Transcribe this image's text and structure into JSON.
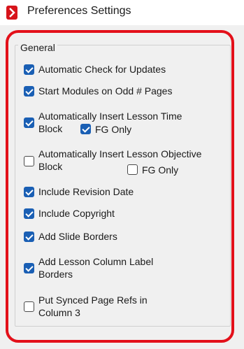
{
  "window": {
    "title": "Preferences Settings",
    "icon": "app-logo-icon"
  },
  "group": {
    "legend": "General"
  },
  "colors": {
    "checked": "#1a5fb4",
    "highlight": "#e3101a"
  },
  "options": {
    "auto_check_updates": {
      "label": "Automatic Check for Updates",
      "checked": true
    },
    "start_odd_pages": {
      "label": "Start Modules on Odd # Pages",
      "checked": true
    },
    "insert_time_block": {
      "label_line1": "Automatically Insert Lesson Time",
      "label_line2": "Block",
      "checked": true
    },
    "time_block_fg_only": {
      "label": "FG Only",
      "checked": true
    },
    "insert_objective_block": {
      "label_line1": "Automatically Insert Lesson Objective",
      "label_line2": "Block",
      "checked": false
    },
    "objective_block_fg_only": {
      "label": "FG Only",
      "checked": false
    },
    "include_revision_date": {
      "label": "Include Revision Date",
      "checked": true
    },
    "include_copyright": {
      "label": "Include Copyright",
      "checked": true
    },
    "add_slide_borders": {
      "label": "Add Slide Borders",
      "checked": true
    },
    "add_column_label_borders": {
      "label_line1": "Add Lesson Column Label",
      "label_line2": "Borders",
      "checked": true
    },
    "synced_page_refs_col3": {
      "label_line1": "Put Synced Page Refs in",
      "label_line2": "Column 3",
      "checked": false
    }
  }
}
